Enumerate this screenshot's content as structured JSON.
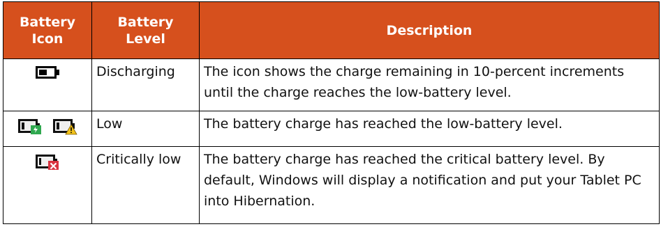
{
  "table": {
    "headers": {
      "icon_line1": "Battery",
      "icon_line2": "Icon",
      "level": "Battery Level",
      "description": "Description"
    },
    "rows": [
      {
        "level": "Discharging",
        "description": "The icon shows the charge remaining in 10-percent increments until the charge reaches the low-battery level.",
        "icons": [
          "battery-discharging-icon"
        ]
      },
      {
        "level": "Low",
        "description": "The battery charge has reached the low-battery level.",
        "icons": [
          "battery-low-plugged-icon",
          "battery-low-warning-icon"
        ]
      },
      {
        "level": "Critically low",
        "description": "The battery charge has reached the critical battery level. By default, Windows will display a notification and put your Tablet PC into Hibernation.",
        "icons": [
          "battery-critical-icon"
        ]
      }
    ]
  },
  "colors": {
    "header_bg": "#d6501d",
    "header_text": "#ffffff",
    "border": "#000000",
    "plug_green": "#2fa84f",
    "warning_yellow": "#f2c21b",
    "critical_red": "#d9333f"
  }
}
